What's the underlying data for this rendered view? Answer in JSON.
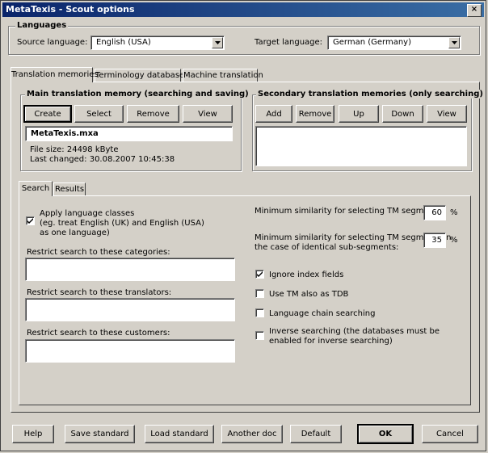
{
  "window": {
    "title": "MetaTexis - Scout options",
    "close_glyph": "×"
  },
  "languages": {
    "group_title": "Languages",
    "source_label": "Source language:",
    "source_value": "English (USA)",
    "target_label": "Target language:",
    "target_value": "German (Germany)"
  },
  "tabs": [
    "Translation memories",
    "Terminology databases",
    "Machine translation"
  ],
  "main_tm": {
    "title": "Main translation memory (searching and saving)",
    "buttons": [
      "Create",
      "Select",
      "Remove",
      "View"
    ],
    "file_name": "MetaTexis.mxa",
    "file_size": "File size: 24498 kByte",
    "last_changed": "Last changed: 30.08.2007 10:45:38"
  },
  "secondary_tm": {
    "title": "Secondary translation memories (only searching)",
    "buttons": [
      "Add",
      "Remove",
      "Up",
      "Down",
      "View"
    ]
  },
  "subtabs": [
    "Search",
    "Results"
  ],
  "search": {
    "apply_classes": {
      "checked": true,
      "label_lines": [
        "Apply language classes",
        "(eg. treat English (UK) and English (USA)",
        "as one language)"
      ]
    },
    "restrict_categories": "Restrict search to these categories:",
    "restrict_translators": "Restrict search to these translators:",
    "restrict_customers": "Restrict search to these customers:",
    "min_similarity_label": "Minimum similarity for selecting TM segments:",
    "min_similarity_value": "60",
    "min_similarity_identical_label": [
      "Minimum similarity for selecting TM segments in",
      "the case of identical sub-segments:"
    ],
    "min_similarity_identical_value": "35",
    "percent": "%",
    "options": [
      {
        "label": [
          "Ignore index fields"
        ],
        "checked": true
      },
      {
        "label": [
          "Use TM also as TDB"
        ],
        "checked": false
      },
      {
        "label": [
          "Language chain searching"
        ],
        "checked": false
      },
      {
        "label": [
          "Inverse searching (the databases must be",
          "enabled for inverse searching)"
        ],
        "checked": false
      }
    ]
  },
  "footer_buttons": [
    "Help",
    "Save standard",
    "Load standard",
    "Another doc",
    "Default",
    "OK",
    "Cancel"
  ]
}
